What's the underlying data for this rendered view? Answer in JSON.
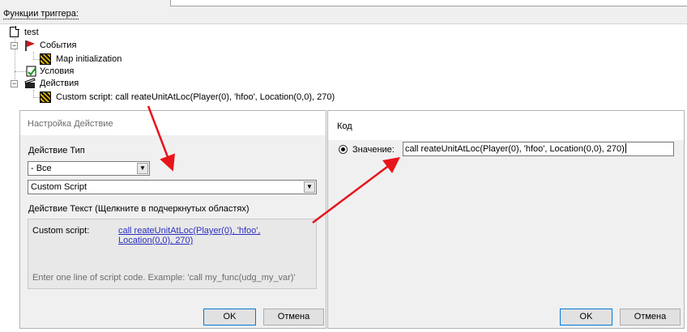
{
  "header": {
    "label": "Функции триггера:"
  },
  "tree": {
    "root": "test",
    "events": "События",
    "event_item": "Map initialization",
    "conditions": "Условия",
    "actions": "Действия",
    "action_item": "Custom script:   call reateUnitAtLoc(Player(0), 'hfoo', Location(0,0), 270)"
  },
  "action_dialog": {
    "title": "Настройка Действие",
    "type_label": "Действие Тип",
    "category_value": "- Все",
    "action_value": "Custom Script",
    "text_label": "Действие Текст (Щелкните в подчеркнутых областях)",
    "script_prefix": "Custom script:",
    "script_link": "call reateUnitAtLoc(Player(0), 'hfoo', Location(0,0), 270)",
    "hint": "Enter one line of script code.  Example: 'call my_func(udg_my_var)'",
    "ok": "OK",
    "cancel": "Отмена"
  },
  "code_dialog": {
    "title": "Код",
    "value_label": "Значение:",
    "value": "call reateUnitAtLoc(Player(0), 'hfoo', Location(0,0), 270)",
    "ok": "OK",
    "cancel": "Отмена"
  },
  "colors": {
    "arrow": "#e8141b",
    "link": "#2a2fbf",
    "focus": "#0078d7"
  }
}
